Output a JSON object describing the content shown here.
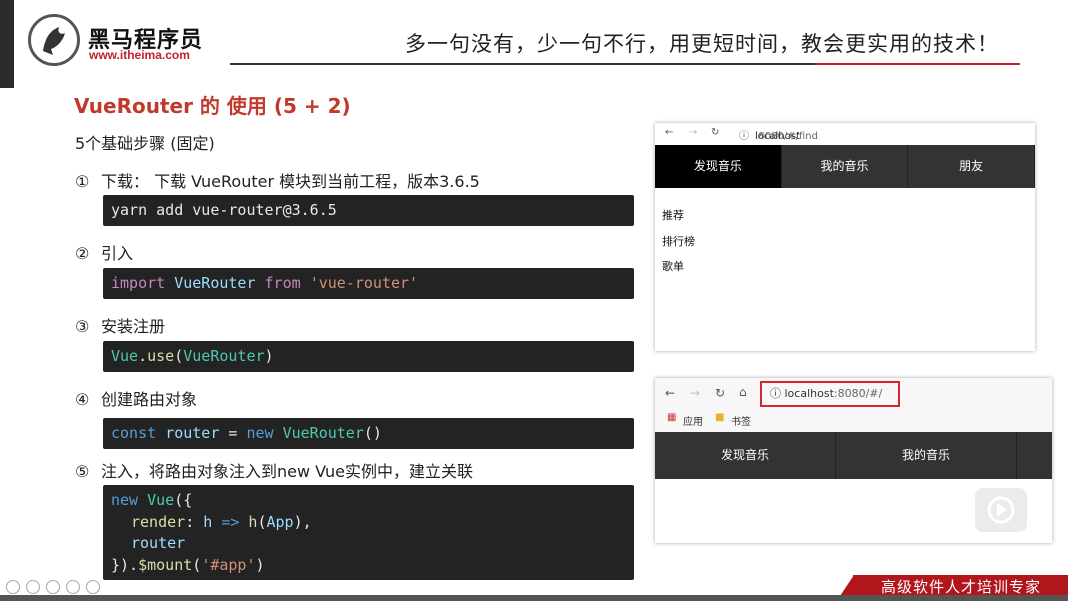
{
  "header": {
    "logo_name": "黑马程序员",
    "logo_url": "www.itheima.com",
    "slogan": "多一句没有，少一句不行，用更短时间，教会更实用的技术！"
  },
  "slide": {
    "title": "VueRouter 的 使用 (5 + 2)",
    "subtitle": "5个基础步骤 (固定)",
    "steps": [
      {
        "num": "①",
        "text": "下载： 下载 VueRouter 模块到当前工程，版本3.6.5"
      },
      {
        "num": "②",
        "text": "引入"
      },
      {
        "num": "③",
        "text": "安装注册"
      },
      {
        "num": "④",
        "text": "创建路由对象"
      },
      {
        "num": "⑤",
        "text": "注入，将路由对象注入到new Vue实例中，建立关联"
      }
    ],
    "code": {
      "c1": "yarn add vue-router@3.6.5",
      "c2_import": "import",
      "c2_cls": "VueRouter",
      "c2_from": "from",
      "c2_str": "'vue-router'",
      "c3_obj": "Vue",
      "c3_dot": ".",
      "c3_fn": "use",
      "c3_open": "(",
      "c3_cls": "VueRouter",
      "c3_close": ")",
      "c4_const": "const",
      "c4_var": "router",
      "c4_eq": "=",
      "c4_new": "new",
      "c4_cls": "VueRouter",
      "c4_paren": "()",
      "c5_l1_new": "new",
      "c5_l1_cls": "Vue",
      "c5_l1_rest": "({",
      "c5_l2_prop": "render",
      "c5_l2_colon": ":",
      "c5_l2_h": "h",
      "c5_l2_arrow": "=>",
      "c5_l2_fn": "h",
      "c5_l2_open": "(",
      "c5_l2_app": "App",
      "c5_l2_close": "),",
      "c5_l3": "router",
      "c5_l4_a": "}).",
      "c5_l4_fn": "$mount",
      "c5_l4_open": "(",
      "c5_l4_str": "'#app'",
      "c5_l4_close": ")"
    }
  },
  "browser1": {
    "url_host": "localhost",
    "url_rest": ":8080/#/find",
    "tabs": [
      "发现音乐",
      "我的音乐",
      "朋友"
    ],
    "sub_items": [
      "推荐",
      "排行榜",
      "歌单"
    ]
  },
  "browser2": {
    "url_host": "localhost",
    "url_rest": ":8080/#/",
    "bookmarks": [
      "应用",
      "书签"
    ],
    "tabs": [
      "发现音乐",
      "我的音乐"
    ]
  },
  "footer": {
    "tagline": "高级软件人才培训专家"
  },
  "colors": {
    "title_red": "#c0392b",
    "brand_red": "#b2161d",
    "code_bg": "#232323",
    "highlight_box": "#d3262e"
  }
}
